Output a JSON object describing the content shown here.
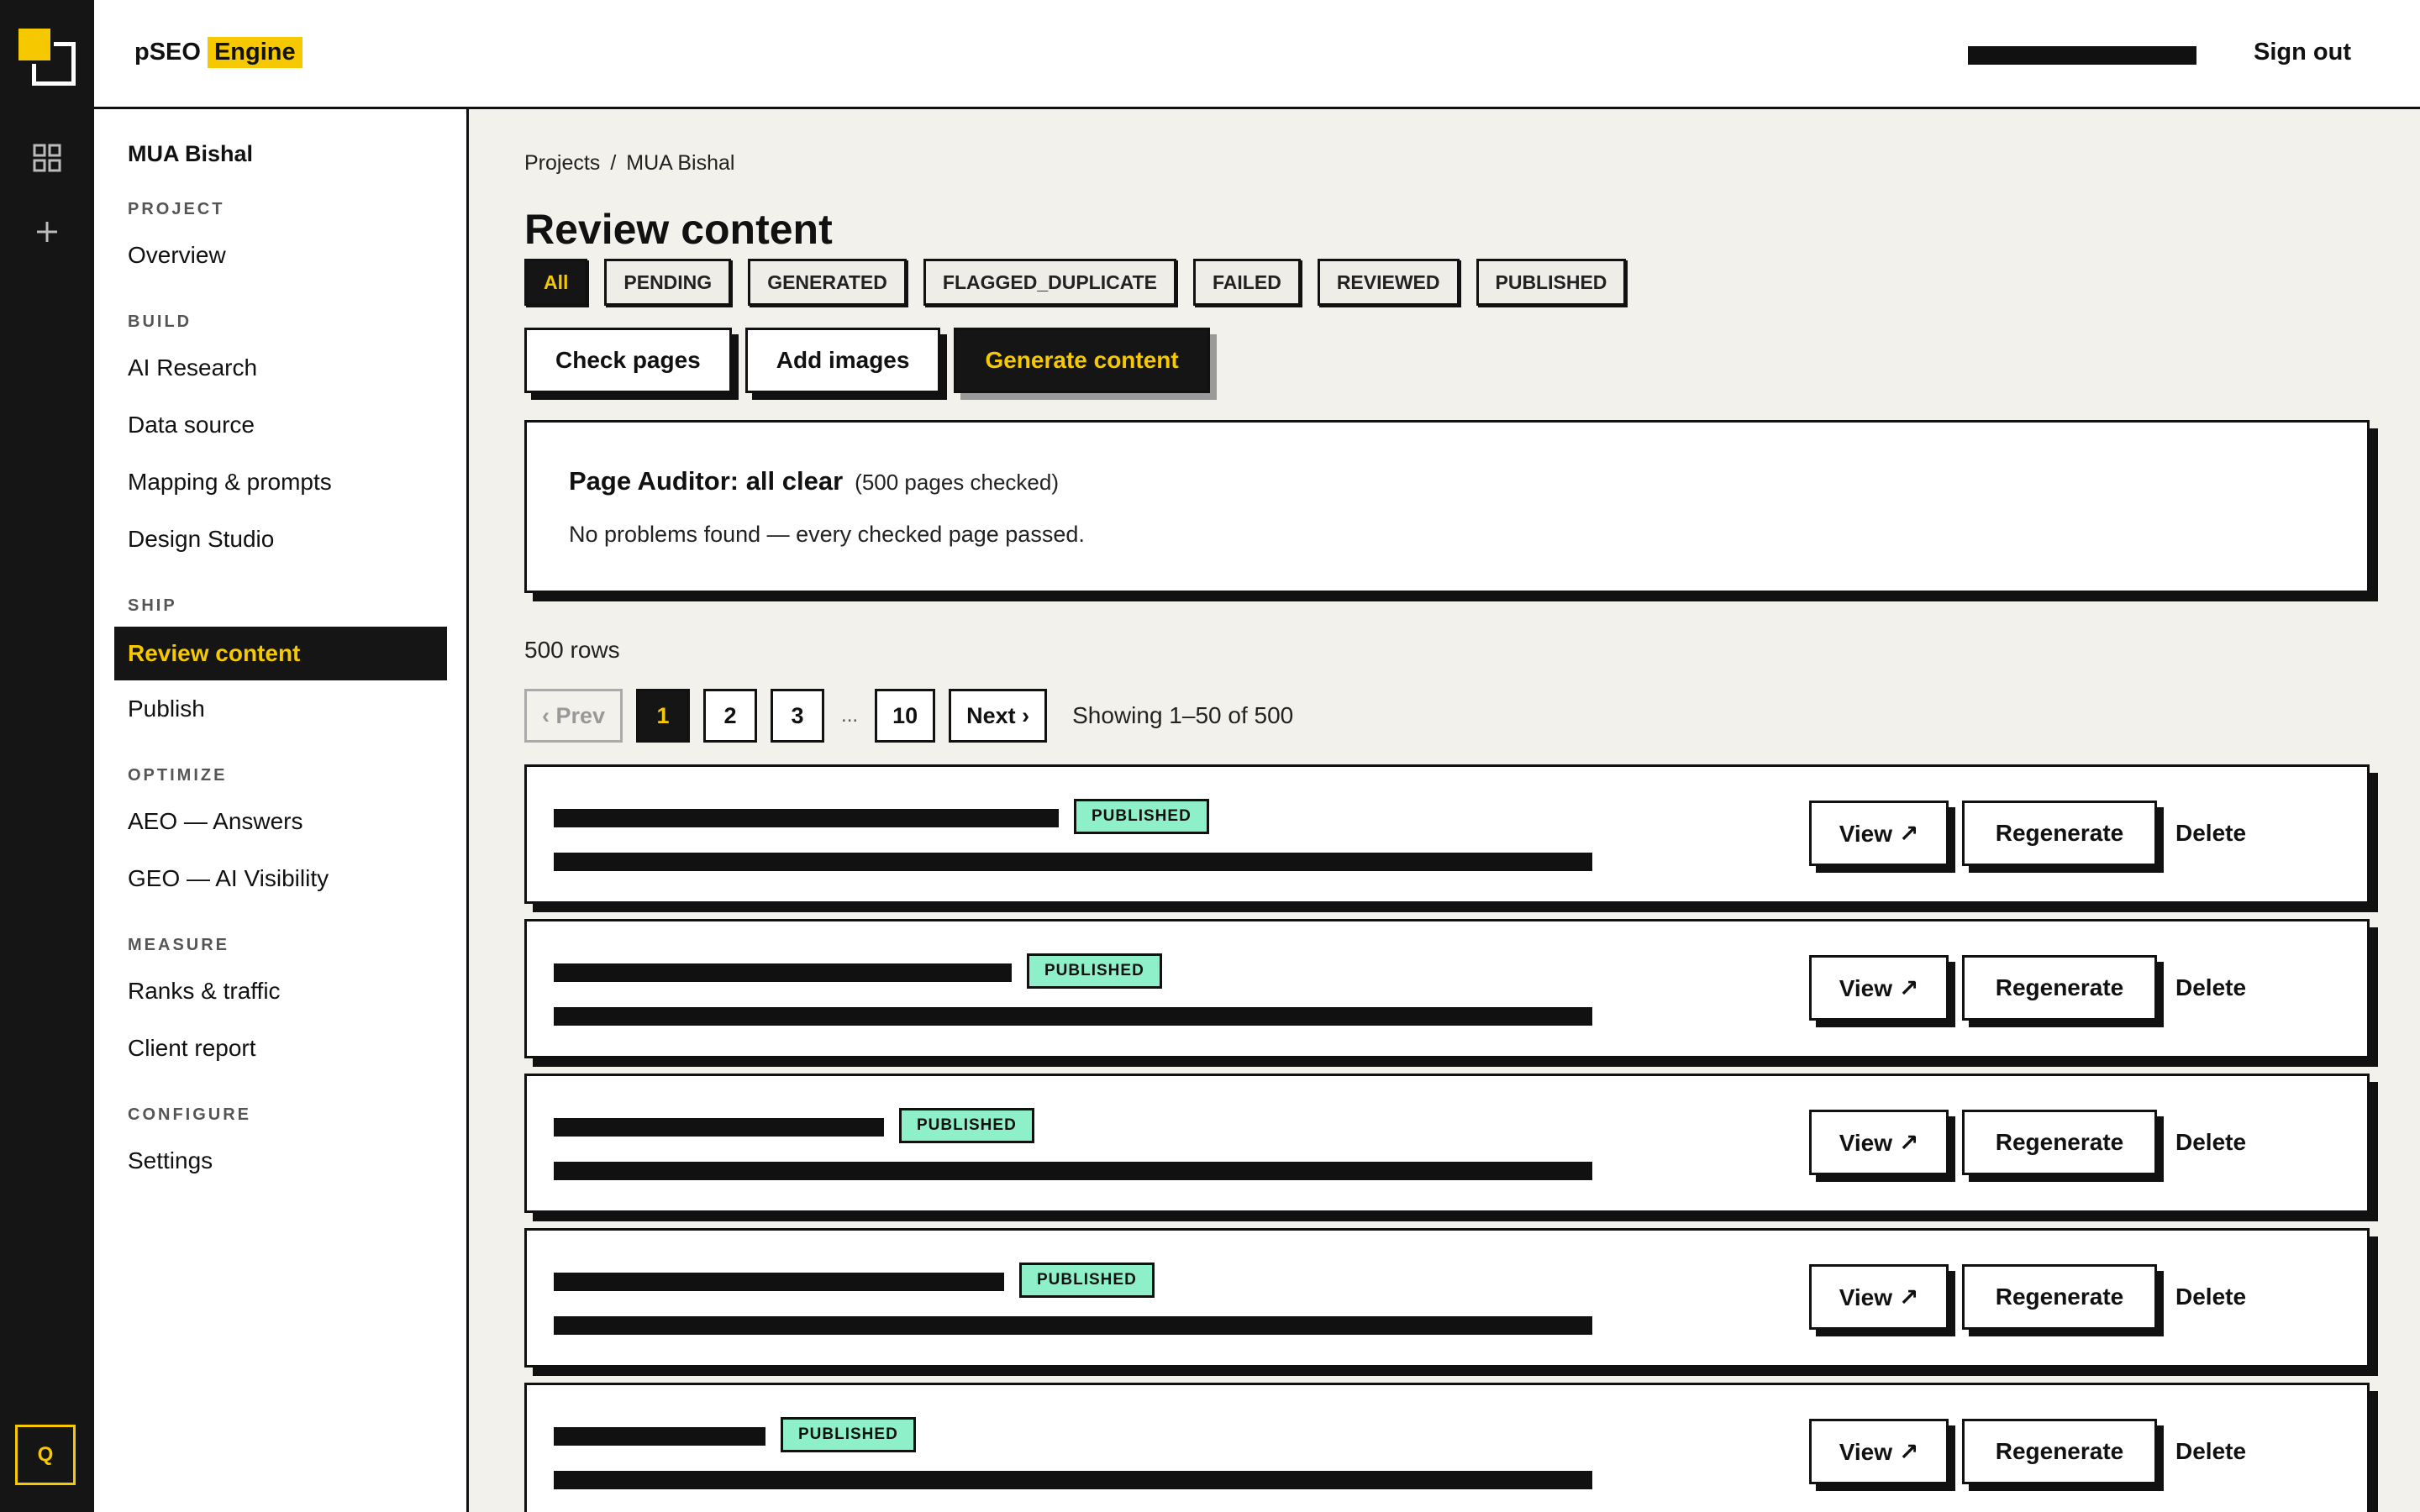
{
  "app": {
    "brand_prefix": "pSEO",
    "brand_highlight": "Engine",
    "sign_out": "Sign out",
    "rail_bottom_label": "Q"
  },
  "sidebar": {
    "project_name": "MUA Bishal",
    "sections": [
      {
        "label": "PROJECT",
        "items": [
          "Overview"
        ]
      },
      {
        "label": "BUILD",
        "items": [
          "AI Research",
          "Data source",
          "Mapping & prompts",
          "Design Studio"
        ]
      },
      {
        "label": "SHIP",
        "items": [
          "Review content",
          "Publish"
        ]
      },
      {
        "label": "OPTIMIZE",
        "items": [
          "AEO — Answers",
          "GEO — AI Visibility"
        ]
      },
      {
        "label": "MEASURE",
        "items": [
          "Ranks & traffic",
          "Client report"
        ]
      },
      {
        "label": "CONFIGURE",
        "items": [
          "Settings"
        ]
      }
    ],
    "active_item": "Review content"
  },
  "breadcrumb": {
    "root": "Projects",
    "separator": "/",
    "current": "MUA Bishal"
  },
  "page_title": "Review content",
  "filters": [
    "All",
    "PENDING",
    "GENERATED",
    "FLAGGED_DUPLICATE",
    "FAILED",
    "REVIEWED",
    "PUBLISHED"
  ],
  "active_filter": "All",
  "actions": {
    "check_pages": "Check pages",
    "add_images": "Add images",
    "generate_content": "Generate content"
  },
  "audit": {
    "title": "Page Auditor: all clear",
    "count": "(500 pages checked)",
    "message": "No problems found — every checked page passed."
  },
  "row_count": "500 rows",
  "pagination": {
    "prev": "‹ Prev",
    "pages": [
      "1",
      "2",
      "3"
    ],
    "ellipsis": "...",
    "last": "10",
    "next": "Next ›",
    "current": "1",
    "showing": "Showing 1–50 of 500"
  },
  "rows": [
    {
      "status": "PUBLISHED",
      "title_redaction_fraction": 0.486
    },
    {
      "status": "PUBLISHED",
      "title_redaction_fraction": 0.441
    },
    {
      "status": "PUBLISHED",
      "title_redaction_fraction": 0.318
    },
    {
      "status": "PUBLISHED",
      "title_redaction_fraction": 0.434
    },
    {
      "status": "PUBLISHED",
      "title_redaction_fraction": 0.204
    }
  ],
  "row_actions": {
    "view": "View ↗",
    "regenerate": "Regenerate",
    "delete": "Delete"
  },
  "colors": {
    "accent": "#f5c800",
    "dark": "#151515",
    "published_badge": "#8ef0c8",
    "background": "#f2f1ec"
  }
}
